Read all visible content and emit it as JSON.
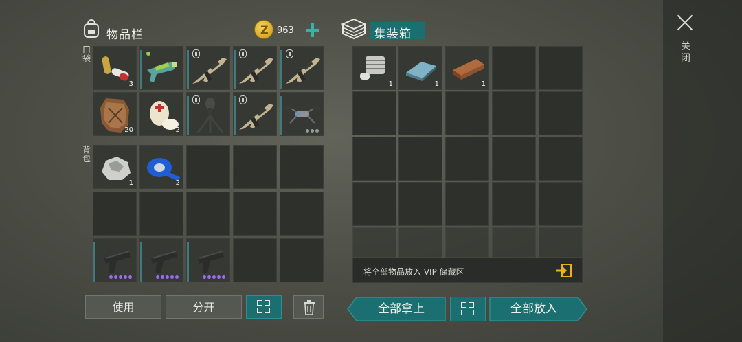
{
  "inventory": {
    "title": "物品栏",
    "coins": "963",
    "section_pocket": "口袋",
    "section_backpack": "背包",
    "pocket_slots": [
      {
        "item": "pills",
        "count": "3"
      },
      {
        "item": "plasma-blaster",
        "count": ""
      },
      {
        "item": "rifle",
        "count": ""
      },
      {
        "item": "rifle",
        "count": ""
      },
      {
        "item": "rifle",
        "count": ""
      },
      {
        "item": "beast-hide",
        "count": "20"
      },
      {
        "item": "bandage",
        "count": "2"
      },
      {
        "item": "tripod-turret",
        "count": ""
      },
      {
        "item": "rifle",
        "count": ""
      },
      {
        "item": "drone",
        "count": ""
      }
    ],
    "backpack_slots": [
      {
        "item": "ore-rock",
        "count": "1"
      },
      {
        "item": "blue-tape",
        "count": "2"
      },
      {
        "item": "pistol",
        "count": ""
      },
      {
        "item": "pistol",
        "count": ""
      },
      {
        "item": "pistol",
        "count": ""
      }
    ]
  },
  "container": {
    "title": "集装箱",
    "slots": [
      {
        "item": "engine-block",
        "count": "1"
      },
      {
        "item": "iron-ingot",
        "count": "1"
      },
      {
        "item": "wood-plank",
        "count": "1"
      }
    ],
    "vip_text": "将全部物品放入 VIP 储藏区"
  },
  "buttons": {
    "use": "使用",
    "split": "分开",
    "take_all": "全部拿上",
    "put_all": "全部放入"
  },
  "close_label": "关闭",
  "colors": {
    "teal": "#1c6f71",
    "gold": "#e2b21c",
    "purple": "#9a6cf0"
  }
}
